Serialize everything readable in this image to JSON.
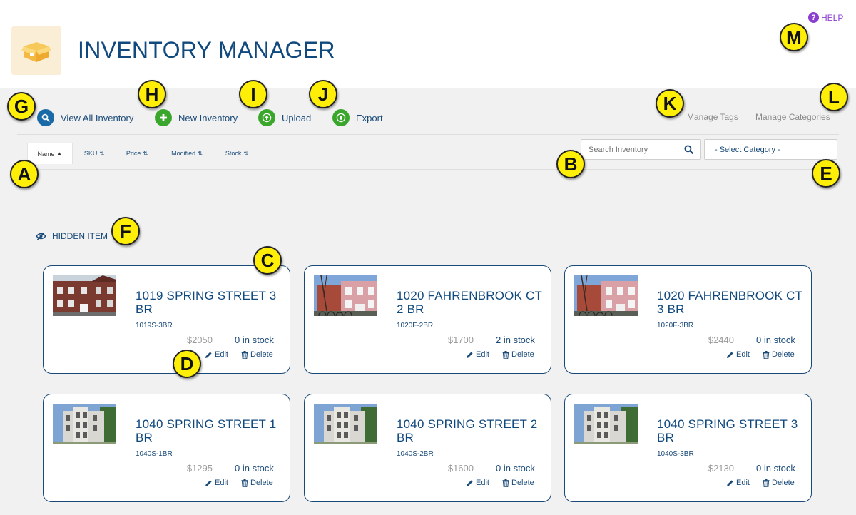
{
  "header": {
    "app_title": "INVENTORY MANAGER",
    "help_label": "HELP",
    "help_glyph": "?"
  },
  "toolbar": {
    "view_all": "View All Inventory",
    "new_inventory": "New Inventory",
    "upload": "Upload",
    "export": "Export",
    "manage_tags": "Manage Tags",
    "manage_categories": "Manage Categories"
  },
  "sort_tabs": [
    "Name",
    "SKU",
    "Price",
    "Modified",
    "Stock"
  ],
  "sort_arrows": {
    "active": "▲",
    "inactive": "⇅"
  },
  "search": {
    "placeholder": "Search Inventory"
  },
  "category_select": {
    "selected": "- Select Category -"
  },
  "hidden_item_label": "HIDDEN ITEM",
  "cards": [
    {
      "title": "1019 SPRING STREET 3 BR",
      "sku": "1019S-3BR",
      "price": "$2050",
      "stock": "0 in stock",
      "edit": "Edit",
      "delete": "Delete",
      "photo": "brick"
    },
    {
      "title": "1020 FAHRENBROOK CT 2 BR",
      "sku": "1020F-2BR",
      "price": "$1700",
      "stock": "2 in stock",
      "edit": "Edit",
      "delete": "Delete",
      "photo": "pink"
    },
    {
      "title": "1020 FAHRENBROOK CT 3 BR",
      "sku": "1020F-3BR",
      "price": "$2440",
      "stock": "0 in stock",
      "edit": "Edit",
      "delete": "Delete",
      "photo": "pink"
    },
    {
      "title": "1040 SPRING STREET 1 BR",
      "sku": "1040S-1BR",
      "price": "$1295",
      "stock": "0 in stock",
      "edit": "Edit",
      "delete": "Delete",
      "photo": "white"
    },
    {
      "title": "1040 SPRING STREET 2 BR",
      "sku": "1040S-2BR",
      "price": "$1600",
      "stock": "0 in stock",
      "edit": "Edit",
      "delete": "Delete",
      "photo": "white"
    },
    {
      "title": "1040 SPRING STREET 3 BR",
      "sku": "1040S-3BR",
      "price": "$2130",
      "stock": "0 in stock",
      "edit": "Edit",
      "delete": "Delete",
      "photo": "white"
    }
  ],
  "callouts": [
    "A",
    "B",
    "C",
    "D",
    "E",
    "F",
    "G",
    "H",
    "I",
    "J",
    "K",
    "L",
    "M"
  ],
  "colors": {
    "primary": "#10497e",
    "help": "#8a3fd1",
    "action_green": "#3aa62c",
    "action_blue": "#1a6aa8",
    "callout_yellow": "#ffef08",
    "background": "#f1f1f1"
  }
}
